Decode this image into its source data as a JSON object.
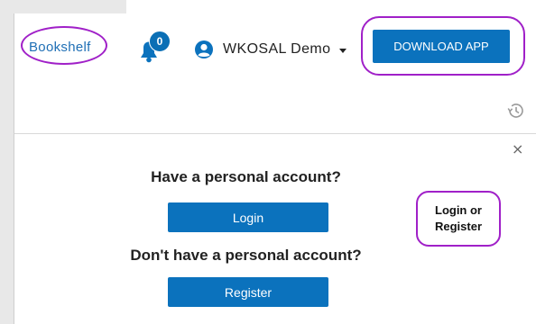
{
  "header": {
    "bookshelf_label": "Bookshelf",
    "notification_count": "0",
    "user_name": "WKOSAL Demo",
    "download_label": "DOWNLOAD APP"
  },
  "panel": {
    "close_label": "×",
    "personal_heading": "Have a personal account?",
    "login_label": "Login",
    "no_personal_heading": "Don't have a personal account?",
    "register_label": "Register"
  },
  "annotation": {
    "line1": "Login or",
    "line2": "Register"
  },
  "icons": [
    "bell-icon",
    "user-avatar-icon",
    "chevron-down-icon",
    "history-icon",
    "close-icon"
  ],
  "colors": {
    "accent": "#0b72bd",
    "highlight": "#a020c8",
    "link": "#1f6fb5"
  }
}
